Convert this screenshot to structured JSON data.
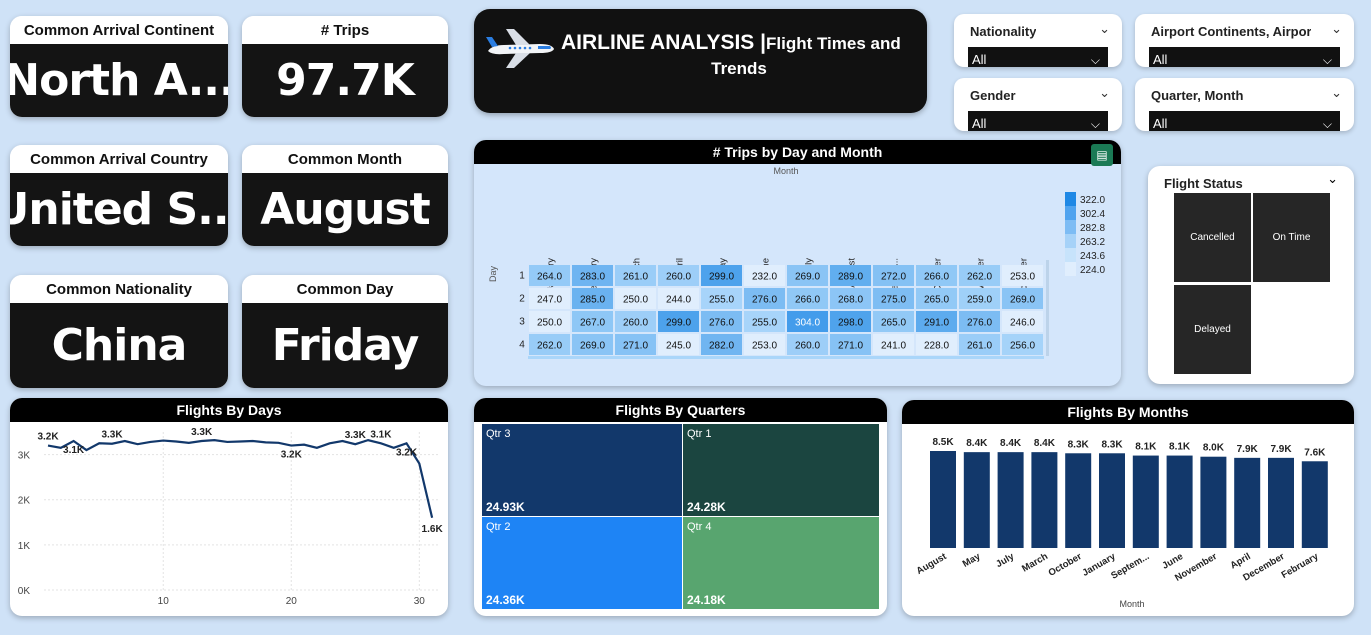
{
  "kpis": [
    {
      "title": "Common Arrival Continent",
      "value": "North A..."
    },
    {
      "title": "# Trips",
      "value": "97.7K"
    },
    {
      "title": "Common Arrival Country",
      "value": "United S..."
    },
    {
      "title": "Common Month",
      "value": "August"
    },
    {
      "title": "Common Nationality",
      "value": "China"
    },
    {
      "title": "Common Day",
      "value": "Friday"
    }
  ],
  "header": {
    "title_main": "AIRLINE ANALYSIS |",
    "title_sub_1": "Flight Times and",
    "title_sub_2": "Trends",
    "icon": "airplane-icon"
  },
  "slicers": [
    {
      "label": "Nationality",
      "value": "All"
    },
    {
      "label": "Airport Continents, Airport ...",
      "value": "All"
    },
    {
      "label": "Gender",
      "value": "All"
    },
    {
      "label": "Quarter, Month",
      "value": "All"
    }
  ],
  "heatmap": {
    "title": "# Trips by Day and Month",
    "col_axis_label": "Month",
    "row_axis_label": "Day",
    "months": [
      "January",
      "February",
      "March",
      "April",
      "May",
      "June",
      "July",
      "August",
      "Septembe...",
      "October",
      "November",
      "December"
    ],
    "rows": [
      {
        "day": "1",
        "values": [
          "264.0",
          "283.0",
          "261.0",
          "260.0",
          "299.0",
          "232.0",
          "269.0",
          "289.0",
          "272.0",
          "266.0",
          "262.0",
          "253.0"
        ]
      },
      {
        "day": "2",
        "values": [
          "247.0",
          "285.0",
          "250.0",
          "244.0",
          "255.0",
          "276.0",
          "266.0",
          "268.0",
          "275.0",
          "265.0",
          "259.0",
          "269.0"
        ]
      },
      {
        "day": "3",
        "values": [
          "250.0",
          "267.0",
          "260.0",
          "299.0",
          "276.0",
          "255.0",
          "304.0",
          "298.0",
          "265.0",
          "291.0",
          "276.0",
          "246.0"
        ]
      },
      {
        "day": "4",
        "values": [
          "262.0",
          "269.0",
          "271.0",
          "245.0",
          "282.0",
          "253.0",
          "260.0",
          "271.0",
          "241.0",
          "228.0",
          "261.0",
          "256.0"
        ]
      }
    ],
    "legend": [
      "322.0",
      "302.4",
      "282.8",
      "263.2",
      "243.6",
      "224.0"
    ]
  },
  "flight_status": {
    "title": "Flight Status",
    "tiles": [
      "Cancelled",
      "On Time",
      "Delayed"
    ]
  },
  "days_chart": {
    "title": "Flights By Days",
    "y_ticks": [
      "3K",
      "2K",
      "1K",
      "0K"
    ],
    "x_ticks": [
      "10",
      "20",
      "30"
    ],
    "labels": [
      "3.2K",
      "3.1K",
      "3.3K",
      "3.3K",
      "3.2K",
      "3.3K",
      "3.1K",
      "3.2K",
      "1.6K"
    ]
  },
  "quarters": {
    "title": "Flights By Quarters",
    "tiles": [
      {
        "label": "Qtr 3",
        "value": "24.93K",
        "color": "#12386b"
      },
      {
        "label": "Qtr 1",
        "value": "24.28K",
        "color": "#1b4540"
      },
      {
        "label": "Qtr 2",
        "value": "24.36K",
        "color": "#1e84f5"
      },
      {
        "label": "Qtr 4",
        "value": "24.18K",
        "color": "#58a56f"
      }
    ]
  },
  "months_chart": {
    "title": "Flights By Months",
    "xlabel": "Month",
    "categories": [
      "August",
      "May",
      "July",
      "March",
      "October",
      "January",
      "Septem...",
      "June",
      "November",
      "April",
      "December",
      "February"
    ],
    "labels": [
      "8.5K",
      "8.4K",
      "8.4K",
      "8.4K",
      "8.3K",
      "8.3K",
      "8.1K",
      "8.1K",
      "8.0K",
      "7.9K",
      "7.9K",
      "7.6K"
    ]
  },
  "chart_data": [
    {
      "type": "line",
      "title": "Flights By Days",
      "x": [
        1,
        2,
        3,
        4,
        5,
        6,
        7,
        8,
        9,
        10,
        11,
        12,
        13,
        14,
        15,
        16,
        17,
        18,
        19,
        20,
        21,
        22,
        23,
        24,
        25,
        26,
        27,
        28,
        29,
        30,
        31
      ],
      "values": [
        3200,
        3150,
        3300,
        3100,
        3250,
        3240,
        3300,
        3230,
        3280,
        3310,
        3290,
        3260,
        3300,
        3320,
        3280,
        3290,
        3300,
        3270,
        3260,
        3200,
        3220,
        3150,
        3250,
        3300,
        3230,
        3320,
        3250,
        3150,
        3250,
        2800,
        1600
      ],
      "ylim": [
        0,
        3500
      ],
      "y_ticks": [
        "0K",
        "1K",
        "2K",
        "3K"
      ],
      "x_ticks": [
        10,
        20,
        30
      ]
    },
    {
      "type": "bar",
      "title": "Flights By Months",
      "xlabel": "Month",
      "categories": [
        "August",
        "May",
        "July",
        "March",
        "October",
        "January",
        "Septem...",
        "June",
        "November",
        "April",
        "December",
        "February"
      ],
      "values": [
        8500,
        8400,
        8400,
        8400,
        8300,
        8300,
        8100,
        8100,
        8000,
        7900,
        7900,
        7600
      ],
      "ylim": [
        0,
        8500
      ],
      "color": "#12386b"
    },
    {
      "type": "heatmap",
      "title": "# Trips by Day and Month",
      "xlabel": "Month",
      "ylabel": "Day",
      "categories": [
        "January",
        "February",
        "March",
        "April",
        "May",
        "June",
        "July",
        "August",
        "Septembe...",
        "October",
        "November",
        "December"
      ],
      "rows": [
        1,
        2,
        3,
        4
      ],
      "values": [
        [
          264,
          283,
          261,
          260,
          299,
          232,
          269,
          289,
          272,
          266,
          262,
          253
        ],
        [
          247,
          285,
          250,
          244,
          255,
          276,
          266,
          268,
          275,
          265,
          259,
          269
        ],
        [
          250,
          267,
          260,
          299,
          276,
          255,
          304,
          298,
          265,
          291,
          276,
          246
        ],
        [
          262,
          269,
          271,
          245,
          282,
          253,
          260,
          271,
          241,
          228,
          261,
          256
        ]
      ]
    }
  ]
}
